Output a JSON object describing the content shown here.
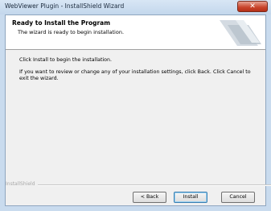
{
  "window": {
    "title": "WebViewer Plugin - InstallShield Wizard",
    "close_glyph": "✕"
  },
  "header": {
    "title": "Ready to Install the Program",
    "subtitle": "The wizard is ready to begin installation."
  },
  "body": {
    "line1": "Click Install to begin the installation.",
    "line2": "If you want to review or change any of your installation settings, click Back. Click Cancel to exit the wizard."
  },
  "footer": {
    "brand": "InstallShield"
  },
  "buttons": {
    "back": "< Back",
    "install": "Install",
    "cancel": "Cancel"
  },
  "colors": {
    "titlebar": "#c9dbee",
    "close": "#c8432a"
  }
}
